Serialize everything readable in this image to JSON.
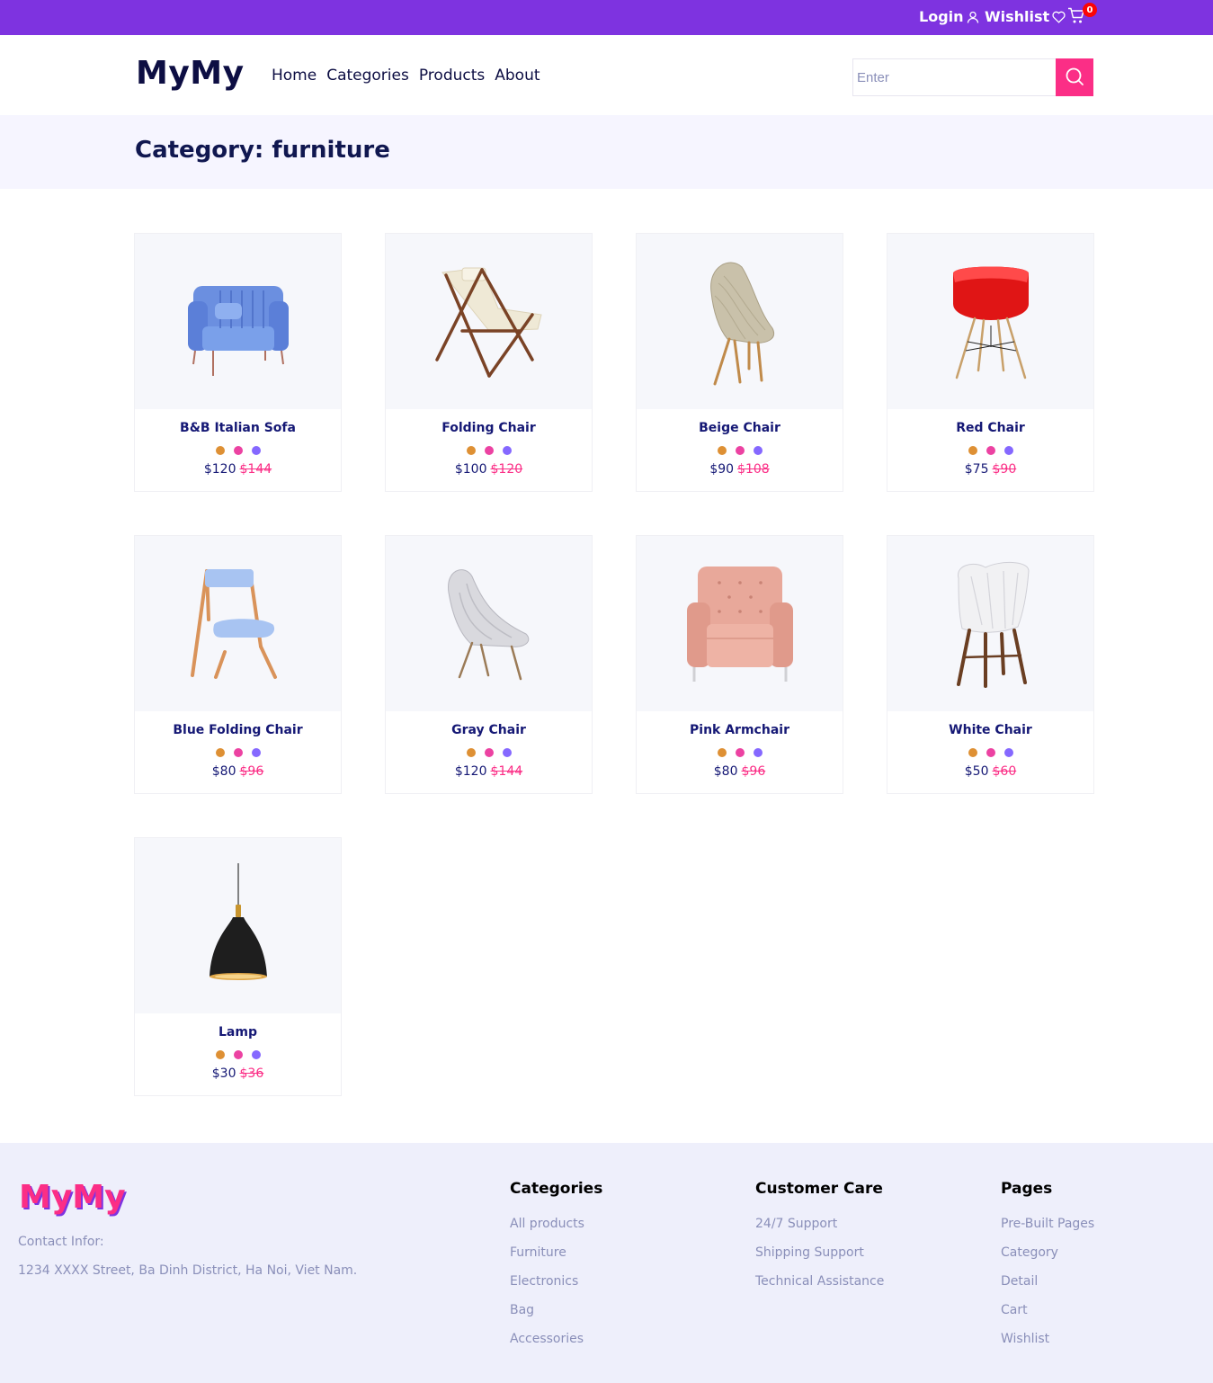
{
  "topbar": {
    "login_label": "Login",
    "wishlist_label": "Wishlist",
    "cart_count": "0",
    "accent_color": "#7e33e0"
  },
  "header": {
    "logo": "MyMy",
    "nav": [
      {
        "label": "Home"
      },
      {
        "label": "Categories"
      },
      {
        "label": "Products"
      },
      {
        "label": "About"
      }
    ],
    "search_placeholder": "Enter",
    "search_button_color": "#fb2e86"
  },
  "banner": {
    "title": "Category: furniture"
  },
  "products": [
    {
      "name": "B&B Italian Sofa",
      "price": "$120",
      "old_price": "$144",
      "image": "blue-sofa"
    },
    {
      "name": "Folding Chair",
      "price": "$100",
      "old_price": "$120",
      "image": "folding-chair"
    },
    {
      "name": "Beige Chair",
      "price": "$90",
      "old_price": "$108",
      "image": "beige-chair"
    },
    {
      "name": "Red Chair",
      "price": "$75",
      "old_price": "$90",
      "image": "red-chair"
    },
    {
      "name": "Blue Folding Chair",
      "price": "$80",
      "old_price": "$96",
      "image": "blue-folding-chair"
    },
    {
      "name": "Gray Chair",
      "price": "$120",
      "old_price": "$144",
      "image": "gray-chair"
    },
    {
      "name": "Pink Armchair",
      "price": "$80",
      "old_price": "$96",
      "image": "pink-armchair"
    },
    {
      "name": "White Chair",
      "price": "$50",
      "old_price": "$60",
      "image": "white-chair"
    },
    {
      "name": "Lamp",
      "price": "$30",
      "old_price": "$36",
      "image": "pendant-lamp"
    }
  ],
  "color_dots": [
    "#de9034",
    "#ec42a2",
    "#8568ff"
  ],
  "footer": {
    "logo": "MyMy",
    "contact_label": "Contact Infor:",
    "contact_address": "1234 XXXX Street, Ba Dinh District, Ha Noi, Viet Nam.",
    "columns": [
      {
        "title": "Categories",
        "links": [
          "All products",
          "Furniture",
          "Electronics",
          "Bag",
          "Accessories"
        ]
      },
      {
        "title": "Customer Care",
        "links": [
          "24/7 Support",
          "Shipping Support",
          "Technical Assistance"
        ]
      },
      {
        "title": "Pages",
        "links": [
          "Pre-Built Pages",
          "Category",
          "Detail",
          "Cart",
          "Wishlist"
        ]
      }
    ]
  }
}
